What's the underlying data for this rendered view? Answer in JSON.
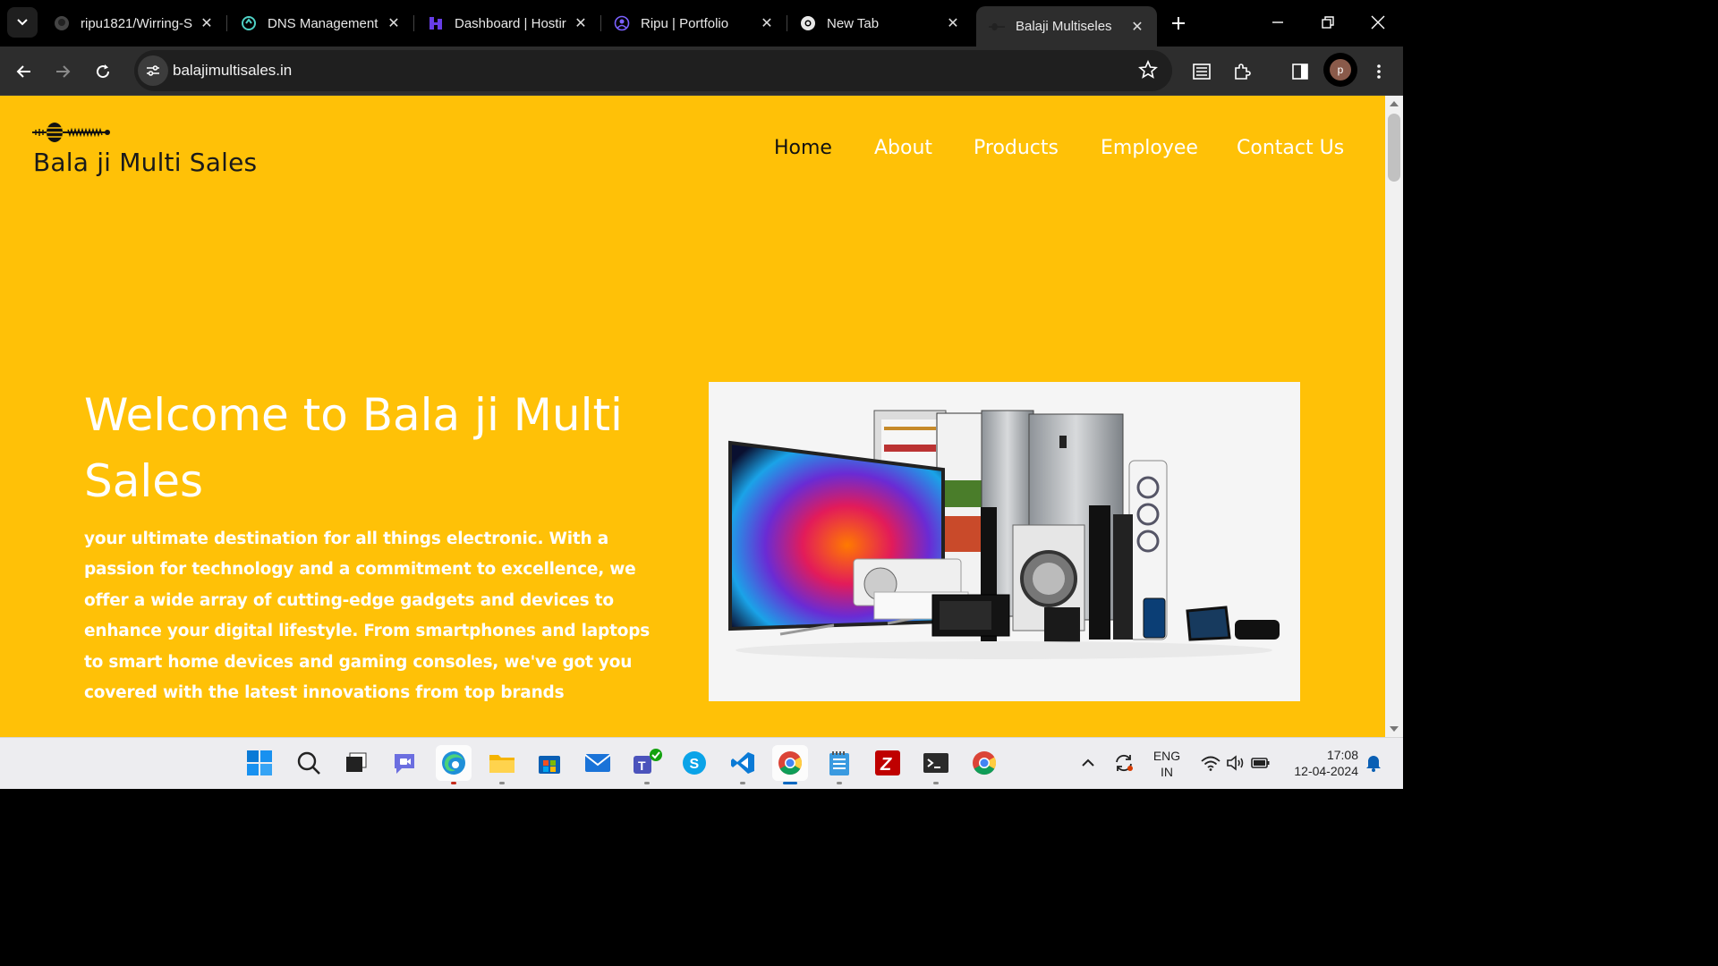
{
  "browser": {
    "tabs": [
      {
        "title": "ripu1821/Wirring-S",
        "icon": "github-icon"
      },
      {
        "title": "DNS Management",
        "icon": "dns-icon"
      },
      {
        "title": "Dashboard | Hostir",
        "icon": "hostinger-icon"
      },
      {
        "title": "Ripu | Portfolio",
        "icon": "portfolio-icon"
      },
      {
        "title": "New Tab",
        "icon": "chrome-icon"
      },
      {
        "title": "Balaji Multiseles",
        "icon": "site-icon",
        "active": true
      }
    ],
    "url": "balajimultisales.in",
    "profile_initial": "p"
  },
  "site": {
    "brand": "Bala ji Multi Sales",
    "nav": [
      "Home",
      "About",
      "Products",
      "Employee",
      "Contact Us"
    ],
    "hero_title": "Welcome to Bala ji Multi Sales",
    "hero_text": "your ultimate destination for all things electronic. With a passion for technology and a commitment to excellence, we offer a wide array of cutting-edge gadgets and devices to enhance your digital lifestyle. From smartphones and laptops to smart home devices and gaming consoles, we've got you covered with the latest innovations from top brands",
    "colors": {
      "background": "#ffc107",
      "text": "#ffffff",
      "nav_active": "#111111"
    }
  },
  "taskbar": {
    "apps": [
      "start-icon",
      "search-icon",
      "task-view-icon",
      "chat-icon",
      "edge-icon",
      "file-explorer-icon",
      "store-icon",
      "mail-icon",
      "teams-icon",
      "skype-icon",
      "vscode-icon",
      "chrome-icon",
      "notepad-icon",
      "filezilla-icon",
      "terminal-icon",
      "chrome-alt-icon"
    ],
    "lang_top": "ENG",
    "lang_bottom": "IN",
    "time": "17:08",
    "date": "12-04-2024"
  }
}
